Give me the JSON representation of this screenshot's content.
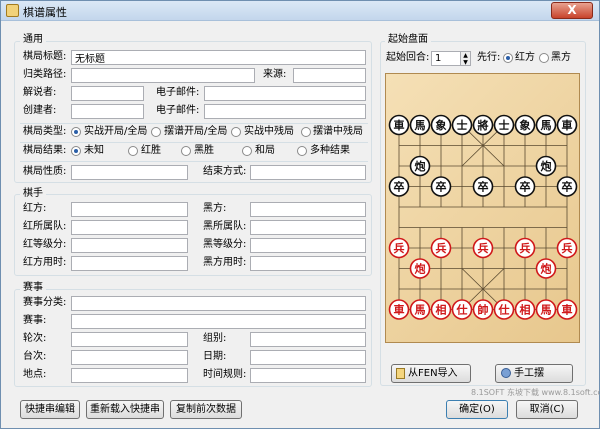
{
  "window": {
    "title": "棋谱属性",
    "close_glyph": "X"
  },
  "general": {
    "group_label": "通用",
    "title_label": "棋局标题:",
    "title_value": "无标题",
    "path_label": "归类路径:",
    "path_value": "",
    "source_label": "来源:",
    "source_value": "",
    "commentator_label": "解说者:",
    "commentator_value": "",
    "email1_label": "电子邮件:",
    "email1_value": "",
    "creator_label": "创建者:",
    "creator_value": "",
    "email2_label": "电子邮件:",
    "email2_value": "",
    "type_label": "棋局类型:",
    "types": [
      "实战开局/全局",
      "摆谱开局/全局",
      "实战中残局",
      "摆谱中残局"
    ],
    "type_selected": 0,
    "result_label": "棋局结果:",
    "results": [
      "未知",
      "红胜",
      "黑胜",
      "和局",
      "多种结果"
    ],
    "result_selected": 0,
    "nature_label": "棋局性质:",
    "nature_value": "",
    "end_label": "结束方式:",
    "end_value": ""
  },
  "players": {
    "group_label": "棋手",
    "red_label": "红方:",
    "black_label": "黑方:",
    "red_team_label": "红所属队:",
    "black_team_label": "黑所属队:",
    "red_rank_label": "红等级分:",
    "black_rank_label": "黑等级分:",
    "red_time_label": "红方用时:",
    "black_time_label": "黑方用时:"
  },
  "match": {
    "group_label": "赛事",
    "category_label": "赛事分类:",
    "event_label": "赛事:",
    "round_label": "轮次:",
    "group_field_label": "组别:",
    "table_label": "台次:",
    "date_label": "日期:",
    "venue_label": "地点:",
    "time_rule_label": "时间规则:"
  },
  "board_panel": {
    "group_label": "起始盘面",
    "start_round_label": "起始回合:",
    "start_round_value": "1",
    "first_move_label": "先行:",
    "first_options": [
      "红方",
      "黑方"
    ],
    "first_selected": 0,
    "from_fen_button": "从FEN导入",
    "manual_button": "手工摆",
    "colors": {
      "red": "#d0181a",
      "black": "#111111",
      "board": "#ecd2a0"
    },
    "black_back": [
      "車",
      "馬",
      "象",
      "士",
      "將",
      "士",
      "象",
      "馬",
      "車"
    ],
    "black_cannon": "炮",
    "black_pawn": "卒",
    "red_back": [
      "車",
      "馬",
      "相",
      "仕",
      "帥",
      "仕",
      "相",
      "馬",
      "車"
    ],
    "red_cannon": "炮",
    "red_pawn": "兵"
  },
  "buttons": {
    "quick_edit": "快捷串编辑",
    "reload": "重新载入快捷串",
    "copy_prev": "复制前次数据",
    "ok": "确定(O)",
    "cancel": "取消(C)"
  },
  "watermark": "8.1SOFT 东坡下载 www.8.1soft.com"
}
